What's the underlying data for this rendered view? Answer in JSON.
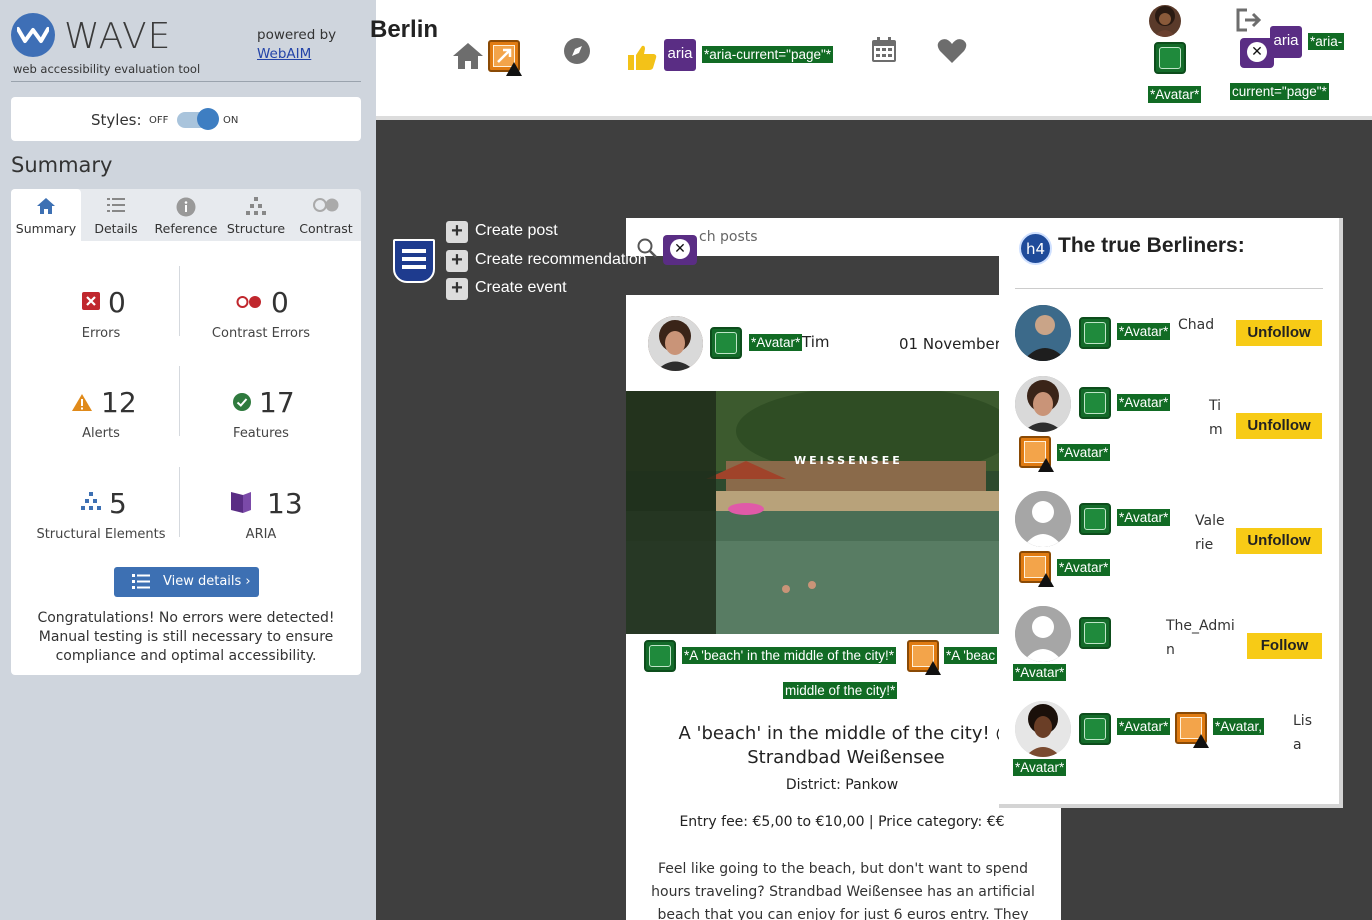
{
  "wave": {
    "title": "WAVE",
    "subtitle": "web accessibility evaluation tool",
    "powered_by": "powered by",
    "webaim_link": "WebAIM",
    "styles_label": "Styles:",
    "styles_off": "OFF",
    "styles_on": "ON",
    "summary_heading": "Summary",
    "tabs": [
      {
        "label": "Summary",
        "icon": "home-icon"
      },
      {
        "label": "Details",
        "icon": "list-icon"
      },
      {
        "label": "Reference",
        "icon": "info-icon"
      },
      {
        "label": "Structure",
        "icon": "hierarchy-icon"
      },
      {
        "label": "Contrast",
        "icon": "contrast-icon"
      }
    ],
    "stats": {
      "errors": {
        "value": "0",
        "label": "Errors"
      },
      "contrast_errors": {
        "value": "0",
        "label": "Contrast Errors"
      },
      "alerts": {
        "value": "12",
        "label": "Alerts"
      },
      "features": {
        "value": "17",
        "label": "Features"
      },
      "structural": {
        "value": "5",
        "label": "Structural Elements"
      },
      "aria": {
        "value": "13",
        "label": "ARIA"
      }
    },
    "view_details": "View details ›",
    "congrats": "Congratulations! No errors were detected! Manual testing is still necessary to ensure compliance and optimal accessibility.",
    "colors": {
      "accent": "#3d70b3",
      "error": "#c0272d",
      "alert": "#e08a1a",
      "feature": "#2f7a3e",
      "aria": "#5a2d84"
    }
  },
  "site": {
    "brand": "Berlin",
    "tag_aria_current": "*aria-current=\"page\"*",
    "tag_avatar": "*Avatar*",
    "tag_aria_current_a": "*aria-",
    "tag_aria_current_b": "current=\"page\"*",
    "aria_label": "aria",
    "create": [
      "Create post",
      "Create recommendation",
      "Create event"
    ],
    "search_placeholder": "ch posts",
    "post": {
      "author_tag": "*Avatar*",
      "author": "Tim",
      "date": "01 November,",
      "image_label_tag": "*A 'beach' in the middle of the city!*",
      "image_label_tag2a": "*A 'beac",
      "image_label_tag2b": "middle of the city!*",
      "image_sign": "WEISSENSEE",
      "title": "A 'beach' in the middle of the city! @ Strandbad Weißensee",
      "district": "District: Pankow",
      "fee": "Entry fee: €5,00 to €10,00 | Price category: €€",
      "text": "Feel like going to the beach, but don't want to spend hours traveling? Strandbad Weißensee has an artificial beach that you can enjoy for just 6 euros entry. They"
    },
    "berliners": {
      "h4": "h4",
      "title": "The true Berliners:",
      "people": [
        {
          "name_lines": [
            "Chad"
          ],
          "button": "Unfollow",
          "tag": "*Avatar*",
          "tag2": ""
        },
        {
          "name_lines": [
            "Ti",
            "m"
          ],
          "button": "Unfollow",
          "tag": "*Avatar*",
          "tag2": "*Avatar*"
        },
        {
          "name_lines": [
            "Vale",
            "rie"
          ],
          "button": "Unfollow",
          "tag": "*Avatar*",
          "tag2": "*Avatar*"
        },
        {
          "name_lines": [
            "The_Admi",
            "n"
          ],
          "button": "Follow",
          "tag": "",
          "tag2": "*Avatar*"
        },
        {
          "name_lines": [
            "Lis",
            "a"
          ],
          "button": "",
          "tag": "*Avatar*",
          "tag2": "*Avatar*",
          "tag3": "*Avatar,"
        }
      ]
    }
  }
}
